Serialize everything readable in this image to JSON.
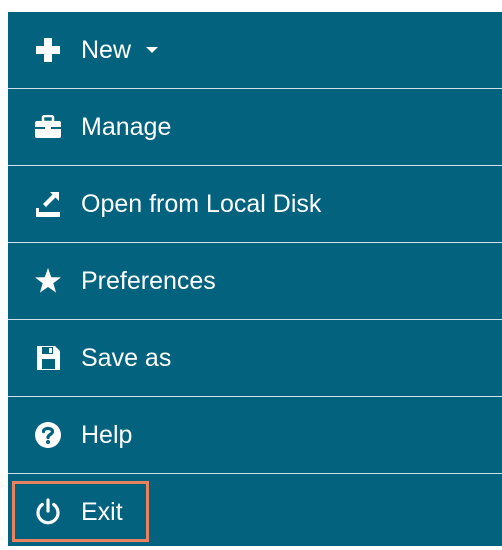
{
  "menu": {
    "items": [
      {
        "label": "New",
        "icon": "plus-icon",
        "has_dropdown": true
      },
      {
        "label": "Manage",
        "icon": "briefcase-icon"
      },
      {
        "label": "Open from Local Disk",
        "icon": "upload-icon"
      },
      {
        "label": "Preferences",
        "icon": "star-icon"
      },
      {
        "label": "Save as",
        "icon": "floppy-disk-icon"
      },
      {
        "label": "Help",
        "icon": "question-circle-icon"
      },
      {
        "label": "Exit",
        "icon": "power-icon",
        "highlighted": true
      }
    ]
  },
  "colors": {
    "menu_background": "#03627e",
    "text": "#ffffff",
    "divider": "#cfe1e7",
    "highlight_border": "#e9825f"
  }
}
